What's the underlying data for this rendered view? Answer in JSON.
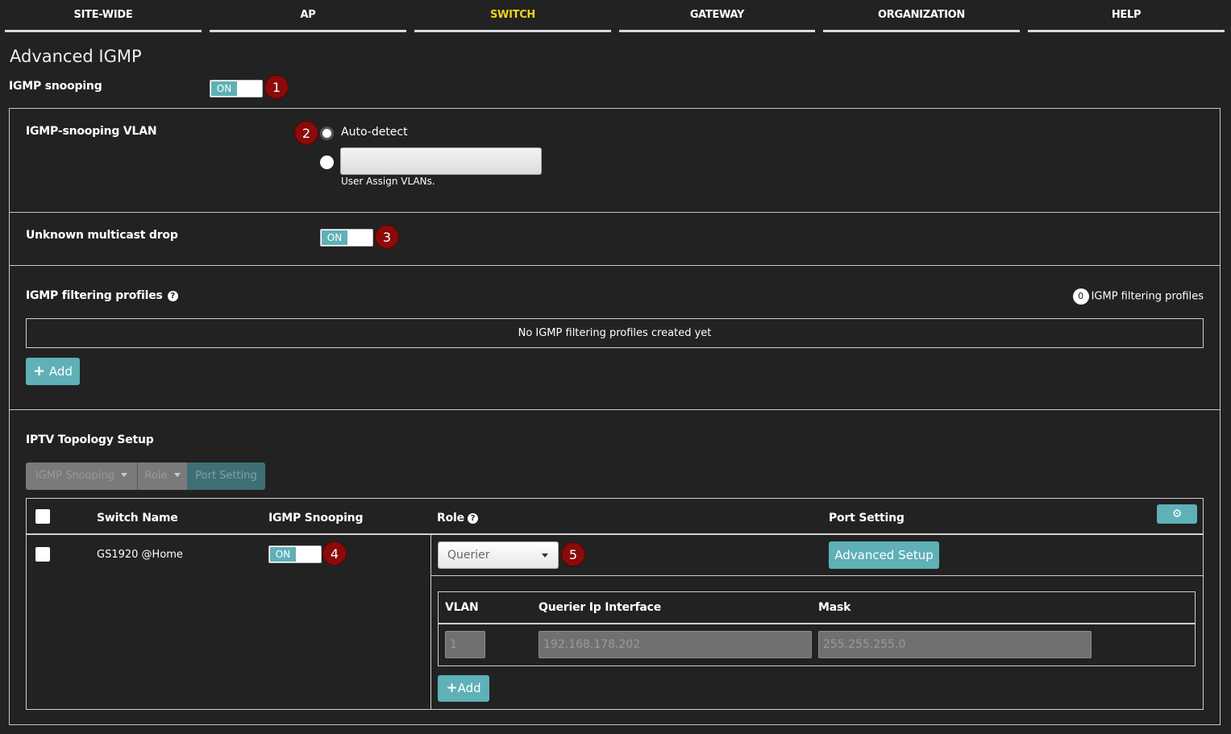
{
  "nav": {
    "tabs": [
      {
        "label": "SITE-WIDE",
        "active": false
      },
      {
        "label": "AP",
        "active": false
      },
      {
        "label": "SWITCH",
        "active": true
      },
      {
        "label": "GATEWAY",
        "active": false
      },
      {
        "label": "ORGANIZATION",
        "active": false
      },
      {
        "label": "HELP",
        "active": false
      }
    ],
    "active_color": "#f2d21b"
  },
  "page": {
    "title": "Advanced IGMP"
  },
  "igmp_snooping": {
    "label": "IGMP snooping",
    "toggle": "ON",
    "badge": "1"
  },
  "vlan": {
    "label": "IGMP-snooping VLAN",
    "badge": "2",
    "option_auto": "Auto-detect",
    "selected": "auto",
    "user_input_value": "",
    "helper": "User Assign VLANs."
  },
  "multicast": {
    "label": "Unknown multicast drop",
    "toggle": "ON",
    "badge": "3"
  },
  "filtering": {
    "label": "IGMP filtering profiles",
    "count": "0",
    "count_label": "IGMP filtering profiles",
    "empty_text": "No IGMP filtering profiles created yet",
    "add_label": "Add"
  },
  "iptv": {
    "label": "IPTV Topology Setup",
    "toolbar": {
      "igmp_snooping": "IGMP Snooping",
      "role": "Role",
      "port_setting": "Port Setting"
    },
    "columns": {
      "switch_name": "Switch Name",
      "igmp_snooping": "IGMP Snooping",
      "role": "Role",
      "port_setting": "Port Setting"
    },
    "row": {
      "switch_name": "GS1920 @Home",
      "toggle": "ON",
      "badge_toggle": "4",
      "role": "Querier",
      "badge_role": "5",
      "advanced_label": "Advanced Setup"
    },
    "querier": {
      "columns": {
        "vlan": "VLAN",
        "ip_interface": "Querier Ip Interface",
        "mask": "Mask"
      },
      "vlan_value": "1",
      "ip_value": "192.168.178.202",
      "mask_value": "255.255.255.0",
      "add_label": "Add"
    }
  },
  "colors": {
    "background": "#222222",
    "accent": "#5fb0b7",
    "badge": "#8b0a0a"
  }
}
